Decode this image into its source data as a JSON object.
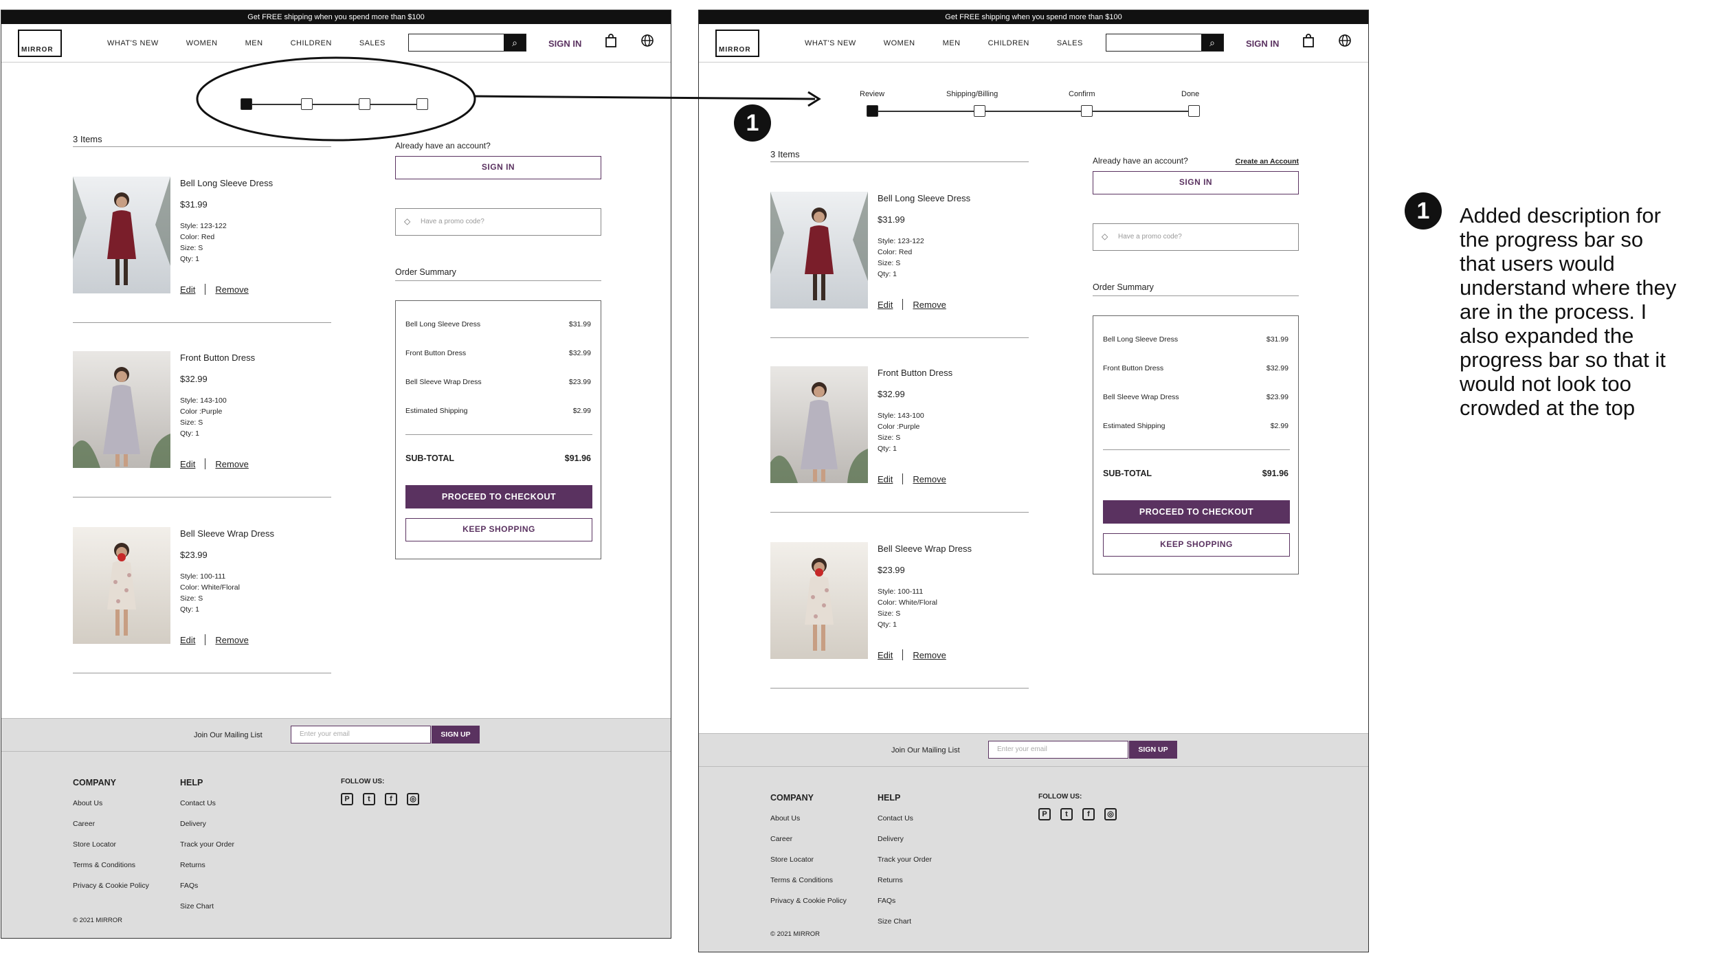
{
  "header": {
    "banner": "Get FREE shipping when you spend more than $100",
    "logo": "MIRROR",
    "nav": [
      "WHAT'S NEW",
      "WOMEN",
      "MEN",
      "CHILDREN",
      "SALES"
    ],
    "sign_in": "SIGN IN"
  },
  "progress": {
    "labels": [
      "Review",
      "Shipping/Billing",
      "Confirm",
      "Done"
    ]
  },
  "cart": {
    "items_count": "3 Items",
    "edit": "Edit",
    "remove": "Remove",
    "items": [
      {
        "name": "Bell Long Sleeve Dress",
        "price": "$31.99",
        "style": "Style: 123-122",
        "color": "Color: Red",
        "size": "Size: S",
        "qty": "Qty: 1"
      },
      {
        "name": "Front Button Dress",
        "price": "$32.99",
        "style": "Style: 143-100",
        "color": "Color :Purple",
        "size": "Size: S",
        "qty": "Qty: 1"
      },
      {
        "name": "Bell Sleeve Wrap Dress",
        "price": "$23.99",
        "style": "Style: 100-111",
        "color": "Color: White/Floral",
        "size": "Size: S",
        "qty": "Qty: 1"
      }
    ]
  },
  "account": {
    "question": "Already have an account?",
    "create": "Create an Account",
    "sign_in": "SIGN IN",
    "promo_placeholder": "Have a promo code?"
  },
  "summary": {
    "title": "Order Summary",
    "rows": [
      {
        "label": "Bell Long Sleeve Dress",
        "value": "$31.99"
      },
      {
        "label": "Front Button Dress",
        "value": "$32.99"
      },
      {
        "label": "Bell Sleeve Wrap Dress",
        "value": "$23.99"
      },
      {
        "label": "Estimated  Shipping",
        "value": "$2.99"
      }
    ],
    "subtotal_label": "SUB-TOTAL",
    "subtotal_value": "$91.96",
    "checkout": "PROCEED TO CHECKOUT",
    "keep": "KEEP SHOPPING"
  },
  "mailing": {
    "label": "Join Our Mailing List",
    "placeholder": "Enter your email",
    "button": "SIGN UP"
  },
  "footer": {
    "company_title": "COMPANY",
    "company": [
      "About Us",
      "Career",
      "Store Locator",
      "Terms & Conditions",
      "Privacy & Cookie Policy"
    ],
    "help_title": "HELP",
    "help": [
      "Contact Us",
      "Delivery",
      "Track your Order",
      "Returns",
      "FAQs",
      "Size Chart"
    ],
    "follow": "FOLLOW US:",
    "social_icons": [
      "pinterest-icon",
      "twitter-icon",
      "facebook-icon",
      "instagram-icon"
    ],
    "copyright": "2021 MIRROR"
  },
  "annotation": {
    "number": "1",
    "text": "Added description for the progress bar so that users would understand where they are in the process. I also expanded the progress bar so that it would not look too crowded at the top"
  },
  "colors": {
    "accent": "#5a3260",
    "dark": "#111111",
    "footer_bg": "#dddddd"
  }
}
